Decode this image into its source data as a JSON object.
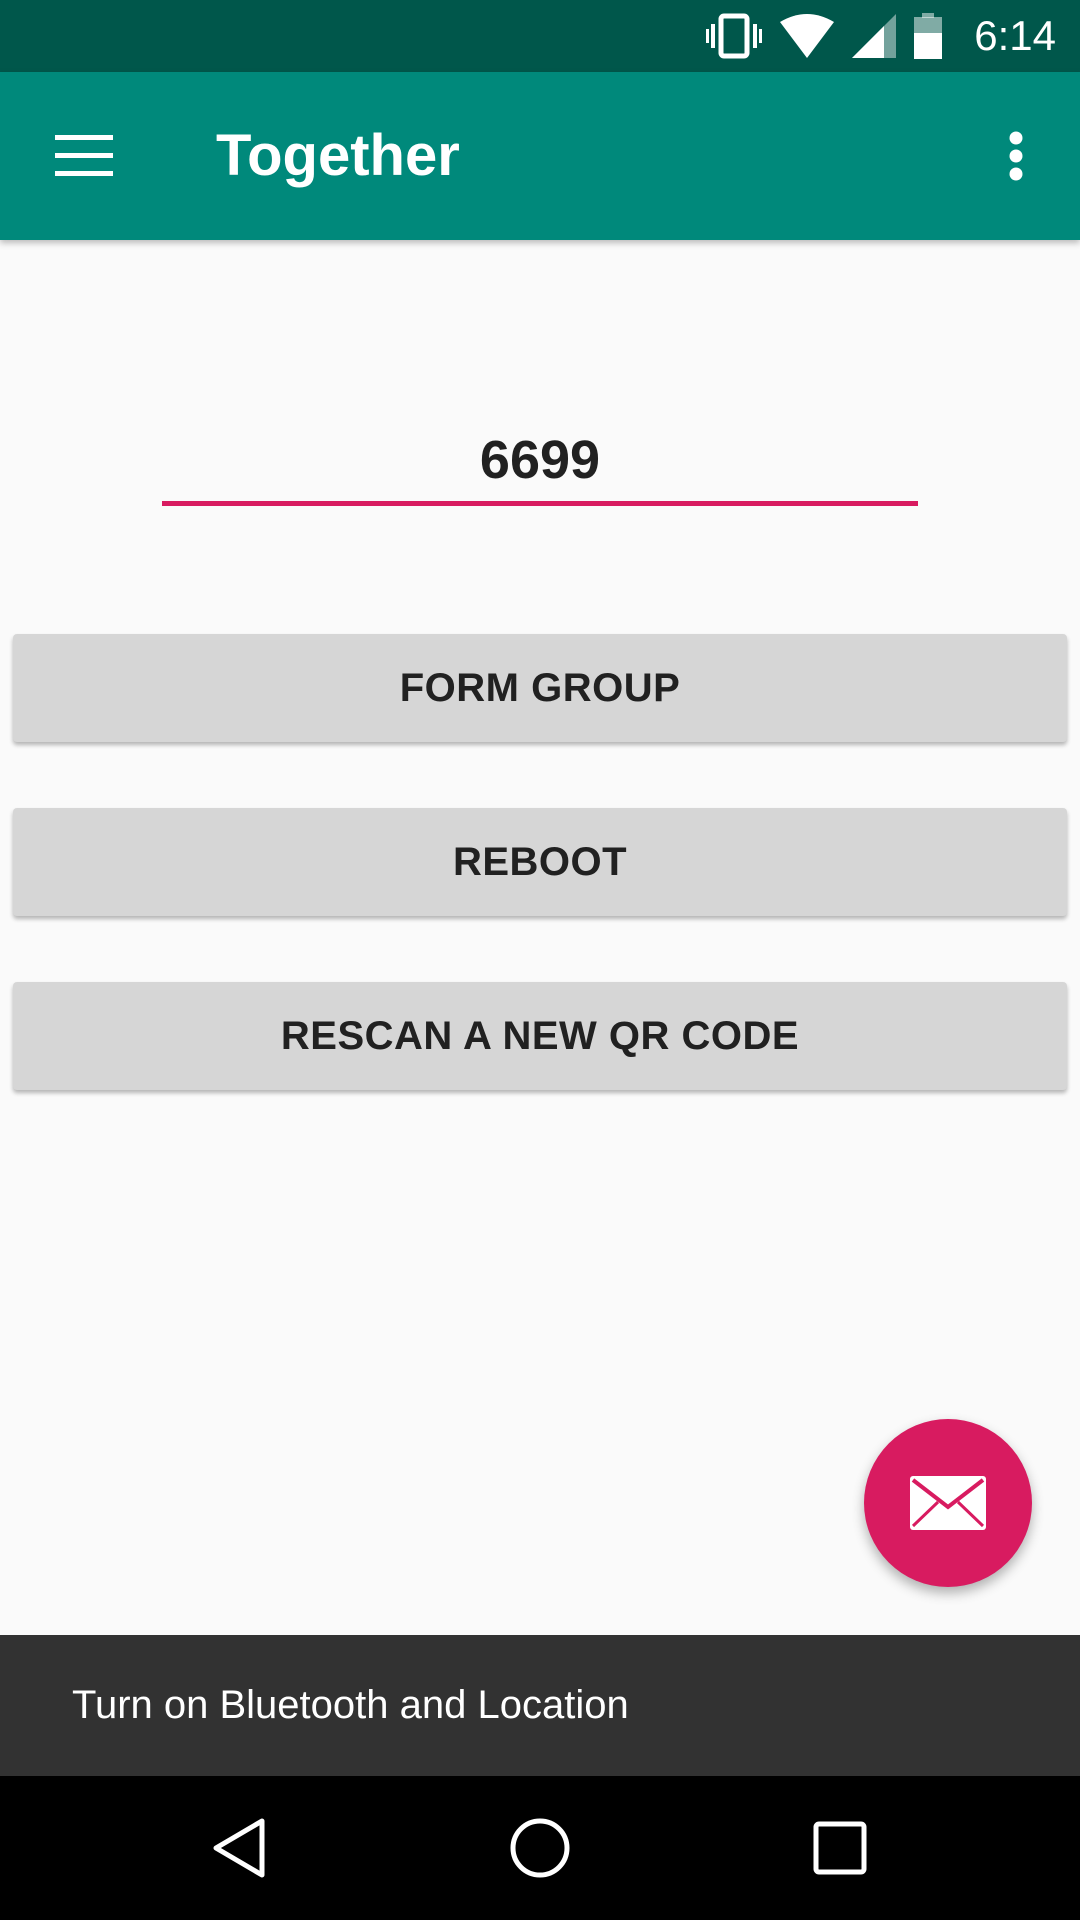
{
  "status_bar": {
    "time": "6:14",
    "icons": [
      "vibrate-icon",
      "wifi-icon",
      "cell-signal-icon",
      "battery-icon"
    ]
  },
  "app_bar": {
    "title": "Together",
    "menu_icon": "hamburger-menu-icon",
    "overflow_icon": "more-vert-icon"
  },
  "code_field": {
    "value": "6699"
  },
  "buttons": {
    "form_group": "FORM GROUP",
    "reboot": "REBOOT",
    "rescan": "RESCAN A NEW QR CODE"
  },
  "fab": {
    "icon": "mail-icon"
  },
  "snackbar": {
    "text": "Turn on Bluetooth and Location"
  },
  "nav_bar": {
    "icons": [
      "back-icon",
      "home-icon",
      "recents-icon"
    ]
  },
  "colors": {
    "primary": "#00897b",
    "primary_dark": "#00574b",
    "accent": "#d81b60",
    "background": "#fafafa",
    "button": "#d6d6d6",
    "snackbar": "#323232"
  }
}
